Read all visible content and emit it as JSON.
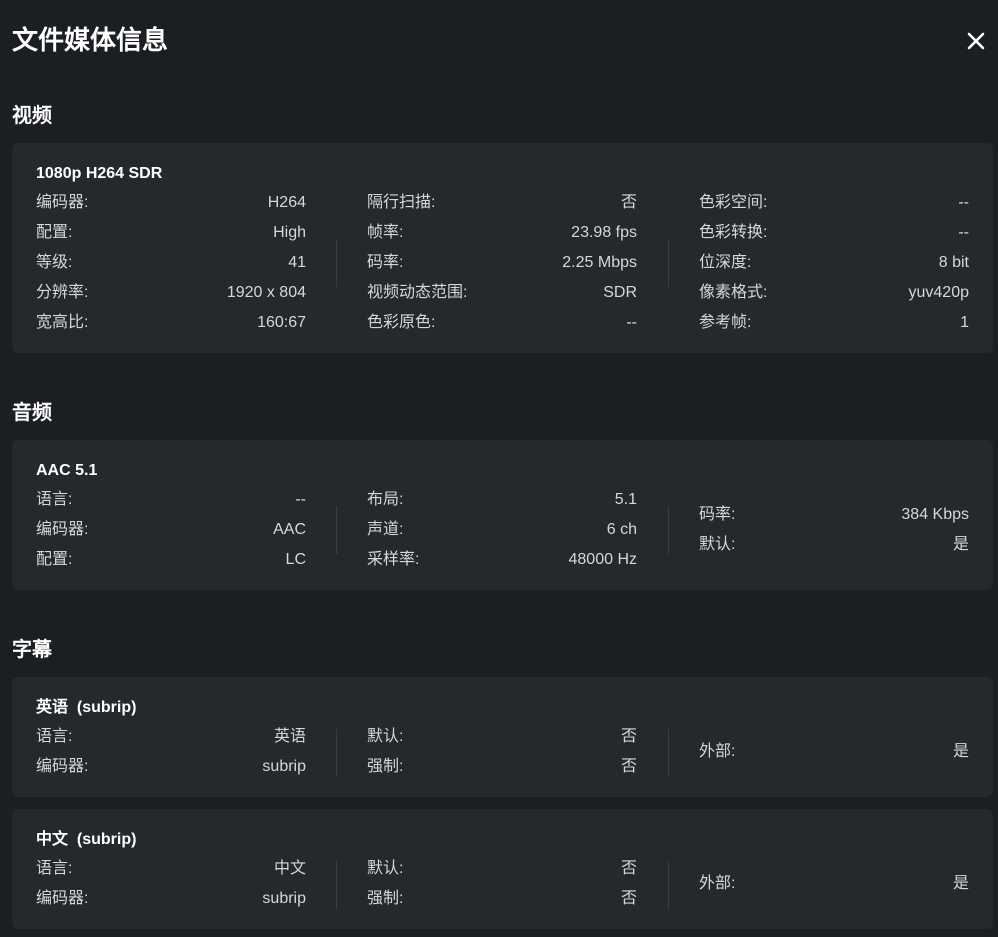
{
  "dialog": {
    "title": "文件媒体信息"
  },
  "video": {
    "section_label": "视频",
    "track_title": "1080p H264 SDR",
    "col1": [
      {
        "label": "编码器:",
        "value": "H264"
      },
      {
        "label": "配置:",
        "value": "High"
      },
      {
        "label": "等级:",
        "value": "41"
      },
      {
        "label": "分辨率:",
        "value": "1920 x 804"
      },
      {
        "label": "宽高比:",
        "value": "160:67"
      }
    ],
    "col2": [
      {
        "label": "隔行扫描:",
        "value": "否"
      },
      {
        "label": "帧率:",
        "value": "23.98 fps"
      },
      {
        "label": "码率:",
        "value": "2.25 Mbps"
      },
      {
        "label": "视频动态范围:",
        "value": "SDR"
      },
      {
        "label": "色彩原色:",
        "value": "--"
      }
    ],
    "col3": [
      {
        "label": "色彩空间:",
        "value": "--"
      },
      {
        "label": "色彩转换:",
        "value": "--"
      },
      {
        "label": "位深度:",
        "value": "8 bit"
      },
      {
        "label": "像素格式:",
        "value": "yuv420p"
      },
      {
        "label": "参考帧:",
        "value": "1"
      }
    ]
  },
  "audio": {
    "section_label": "音频",
    "track_title": "AAC 5.1",
    "col1": [
      {
        "label": "语言:",
        "value": "--"
      },
      {
        "label": "编码器:",
        "value": "AAC"
      },
      {
        "label": "配置:",
        "value": "LC"
      }
    ],
    "col2": [
      {
        "label": "布局:",
        "value": "5.1"
      },
      {
        "label": "声道:",
        "value": "6 ch"
      },
      {
        "label": "采样率:",
        "value": "48000 Hz"
      }
    ],
    "col3": [
      {
        "label": "码率:",
        "value": "384 Kbps"
      },
      {
        "label": "默认:",
        "value": "是"
      }
    ]
  },
  "subtitles": {
    "section_label": "字幕",
    "tracks": [
      {
        "track_title": "英语  (subrip)",
        "col1": [
          {
            "label": "语言:",
            "value": "英语"
          },
          {
            "label": "编码器:",
            "value": "subrip"
          }
        ],
        "col2": [
          {
            "label": "默认:",
            "value": "否"
          },
          {
            "label": "强制:",
            "value": "否"
          }
        ],
        "col3": [
          {
            "label": "外部:",
            "value": "是"
          }
        ]
      },
      {
        "track_title": "中文  (subrip)",
        "col1": [
          {
            "label": "语言:",
            "value": "中文"
          },
          {
            "label": "编码器:",
            "value": "subrip"
          }
        ],
        "col2": [
          {
            "label": "默认:",
            "value": "否"
          },
          {
            "label": "强制:",
            "value": "否"
          }
        ],
        "col3": [
          {
            "label": "外部:",
            "value": "是"
          }
        ]
      }
    ]
  },
  "colors": {
    "background": "#1b1e22",
    "card": "#25282d",
    "text": "#d5d7da",
    "heading": "#ffffff"
  }
}
